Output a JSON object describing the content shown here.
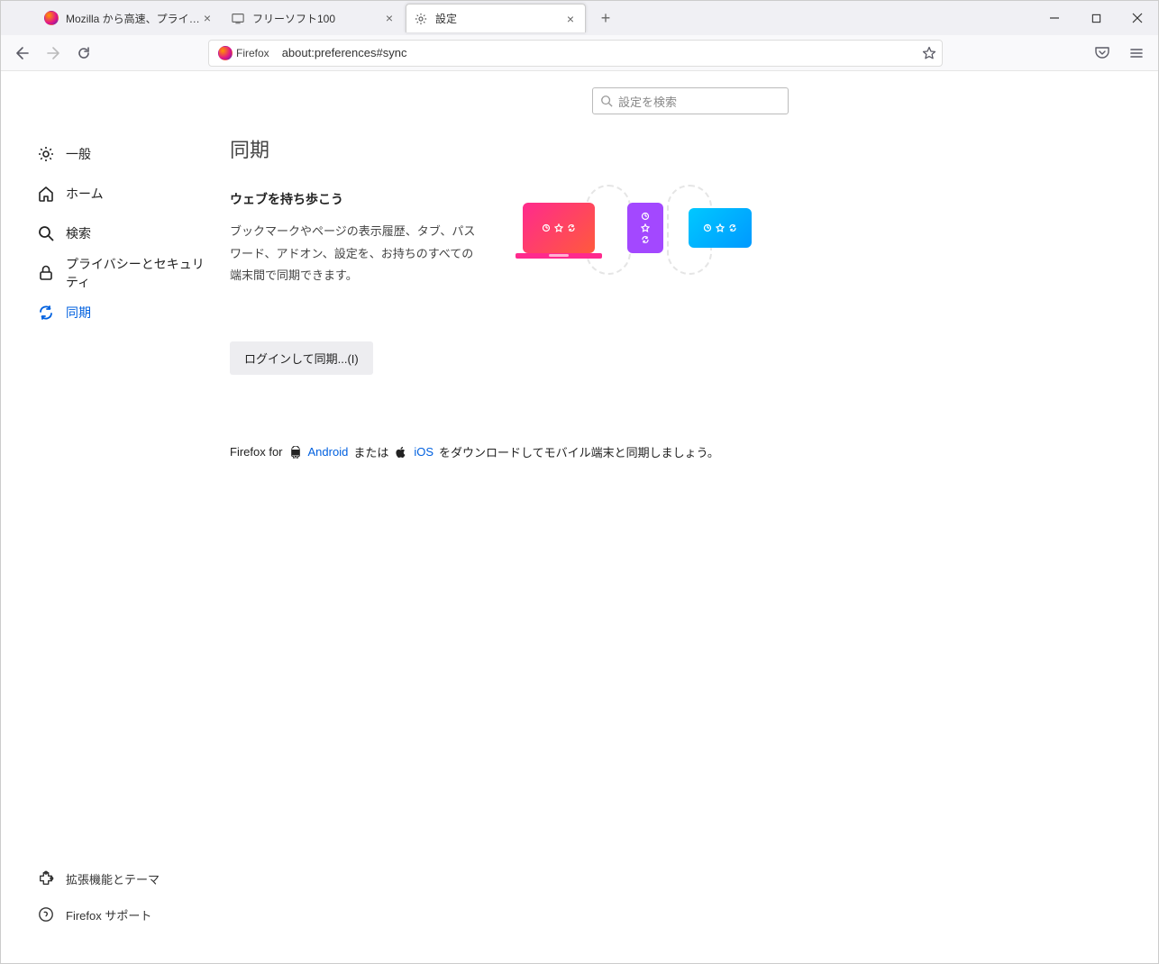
{
  "tabs": [
    {
      "label": "Mozilla から高速、プライベート、無..."
    },
    {
      "label": "フリーソフト100"
    },
    {
      "label": "設定"
    }
  ],
  "url": "about:preferences#sync",
  "urlIdentity": "Firefox",
  "settingsSearch": {
    "placeholder": "設定を検索"
  },
  "sidebar": {
    "items": [
      {
        "label": "一般"
      },
      {
        "label": "ホーム"
      },
      {
        "label": "検索"
      },
      {
        "label": "プライバシーとセキュリティ"
      },
      {
        "label": "同期"
      }
    ],
    "bottom": [
      {
        "label": "拡張機能とテーマ"
      },
      {
        "label": "Firefox サポート"
      }
    ]
  },
  "main": {
    "heading": "同期",
    "subheading": "ウェブを持ち歩こう",
    "description": "ブックマークやページの表示履歴、タブ、パスワード、アドオン、設定を、お持ちのすべての端末間で同期できます。",
    "loginButton": "ログインして同期...(I)",
    "download": {
      "prefix": "Firefox for",
      "androidLabel": "Android",
      "middle": "または",
      "iosLabel": "iOS",
      "suffix": "をダウンロードしてモバイル端末と同期しましょう。"
    }
  }
}
